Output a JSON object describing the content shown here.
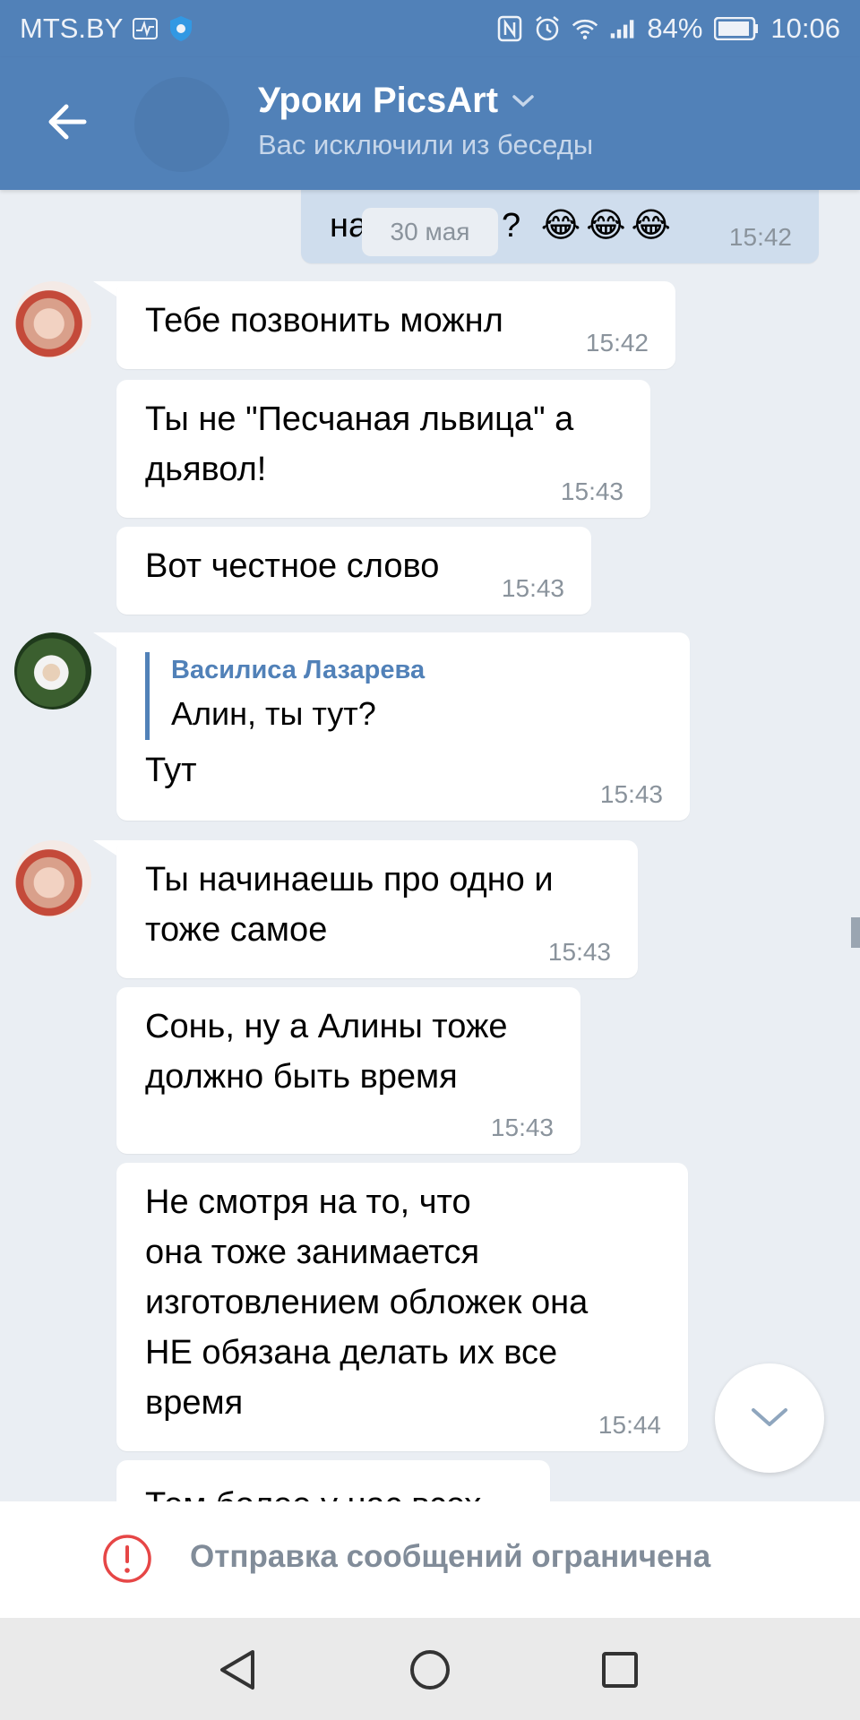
{
  "status_bar": {
    "carrier": "MTS.BY",
    "battery": "84%",
    "time": "10:06",
    "icons": [
      "activity-icon",
      "shield-icon",
      "nfc-icon",
      "alarm-icon",
      "wifi-icon",
      "signal-icon",
      "battery-icon"
    ]
  },
  "header": {
    "title": "Уроки PicsArt",
    "subtitle": "Вас исключили из беседы"
  },
  "date_chip": "30 мая",
  "messages": [
    {
      "text_start": "на",
      "text_end": "? 😂😂😂",
      "time": "15:42",
      "direction": "out"
    },
    {
      "text": "Тебе позвонить можнл",
      "time": "15:42"
    },
    {
      "text": "Ты не \"Песчаная львица\" а",
      "text2": "дьявол!",
      "time": "15:43"
    },
    {
      "text": "Вот честное слово",
      "time": "15:43"
    },
    {
      "reply_name": "Василиса Лазарева",
      "reply_text": "Алин, ты тут?",
      "text": "Тут",
      "time": "15:43"
    },
    {
      "text": "Ты начинаешь про одно и",
      "text2": "тоже самое",
      "time": "15:43"
    },
    {
      "text": "Сонь, ну а Алины тоже",
      "text2": "должно быть время",
      "time": "15:43"
    },
    {
      "lines": [
        "Не смотря на то, что",
        "она тоже занимается",
        "изготовлением обложек она",
        "НЕ обязана делать их все",
        "время"
      ],
      "time": "15:44"
    },
    {
      "text": "Тем более у нас всех"
    }
  ],
  "restriction": {
    "text": "Отправка сообщений ограничена"
  },
  "colors": {
    "header": "#5181b8",
    "background": "#eaeef3",
    "bubble_in": "#ffffff",
    "bubble_out": "#cfdded",
    "accent": "#5181b8",
    "warning": "#e64646"
  }
}
